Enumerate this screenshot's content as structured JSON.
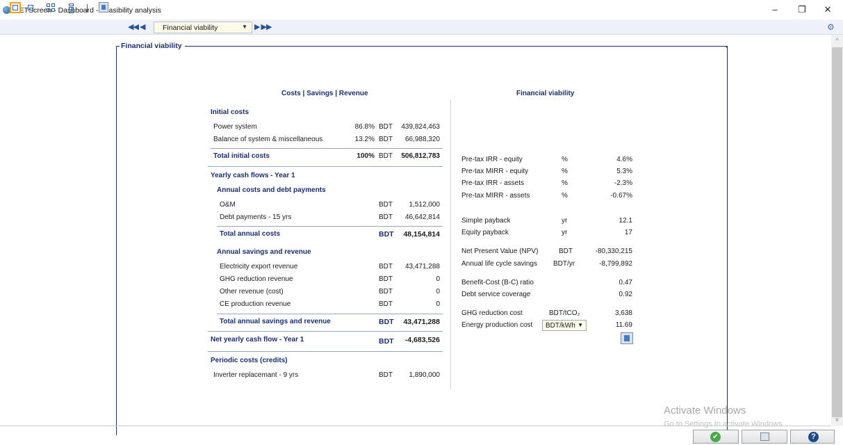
{
  "window": {
    "title": "RETScreen - Dashboard - Feasibility analysis",
    "minimize": "–",
    "restore": "❐",
    "close": "✕"
  },
  "toolbar": {
    "nav_back": "◀◀ ◀",
    "nav_forward": "▶ ▶▶",
    "selector_value": "Financial viability"
  },
  "panel": {
    "title": "Financial viability"
  },
  "left": {
    "heading": "Costs | Savings | Revenue",
    "initial_costs": {
      "title": "Initial costs",
      "rows": [
        {
          "label": "Power system",
          "pct": "86.8%",
          "unit": "BDT",
          "value": "439,824,463"
        },
        {
          "label": "Balance of system & miscellaneous",
          "pct": "13.2%",
          "unit": "BDT",
          "value": "66,988,320"
        }
      ],
      "total": {
        "label": "Total initial costs",
        "pct": "100%",
        "unit": "BDT",
        "value": "506,812,783"
      }
    },
    "yearly": {
      "title": "Yearly cash flows - Year 1",
      "annual_costs": {
        "title": "Annual costs and debt payments",
        "rows": [
          {
            "label": "O&M",
            "unit": "BDT",
            "value": "1,512,000"
          },
          {
            "label": "Debt payments - 15 yrs",
            "unit": "BDT",
            "value": "46,642,814"
          }
        ],
        "total": {
          "label": "Total annual costs",
          "unit": "BDT",
          "value": "48,154,814"
        }
      },
      "annual_savings": {
        "title": "Annual savings and revenue",
        "rows": [
          {
            "label": "Electricity export revenue",
            "unit": "BDT",
            "value": "43,471,288"
          },
          {
            "label": "GHG reduction revenue",
            "unit": "BDT",
            "value": "0"
          },
          {
            "label": "Other revenue (cost)",
            "unit": "BDT",
            "value": "0"
          },
          {
            "label": "CE production revenue",
            "unit": "BDT",
            "value": "0"
          }
        ],
        "total": {
          "label": "Total annual savings and revenue",
          "unit": "BDT",
          "value": "43,471,288"
        }
      },
      "net": {
        "label": "Net yearly cash flow - Year 1",
        "unit": "BDT",
        "value": "-4,683,526"
      }
    },
    "periodic": {
      "title": "Periodic costs (credits)",
      "rows": [
        {
          "label": "Inverter replacemant - 9 yrs",
          "unit": "BDT",
          "value": "1,890,000"
        }
      ]
    }
  },
  "right": {
    "heading": "Financial viability",
    "irr": [
      {
        "label": "Pre-tax IRR - equity",
        "unit": "%",
        "value": "4.6%"
      },
      {
        "label": "Pre-tax MIRR - equity",
        "unit": "%",
        "value": "5.3%"
      },
      {
        "label": "Pre-tax IRR - assets",
        "unit": "%",
        "value": "-2.3%"
      },
      {
        "label": "Pre-tax MIRR - assets",
        "unit": "%",
        "value": "-0.67%"
      }
    ],
    "payback": [
      {
        "label": "Simple payback",
        "unit": "yr",
        "value": "12.1"
      },
      {
        "label": "Equity payback",
        "unit": "yr",
        "value": "17"
      }
    ],
    "npv": [
      {
        "label": "Net Present Value (NPV)",
        "unit": "BDT",
        "value": "-80,330,215"
      },
      {
        "label": "Annual life cycle savings",
        "unit": "BDT/yr",
        "value": "-8,799,892"
      }
    ],
    "ratios": [
      {
        "label": "Benefit-Cost (B-C) ratio",
        "value": "0.47"
      },
      {
        "label": "Debt service coverage",
        "value": "0.92"
      }
    ],
    "ghg": {
      "label": "GHG reduction cost",
      "unit": "BDT/tCO₂",
      "value": "3,638"
    },
    "energy": {
      "label": "Energy production cost",
      "unit": "BDT/kWh",
      "value": "11.69"
    }
  },
  "watermark": {
    "line1": "Activate Windows",
    "line2": "Go to Settings to activate Windows."
  },
  "icons": {
    "ok": "✔",
    "help": "?"
  }
}
